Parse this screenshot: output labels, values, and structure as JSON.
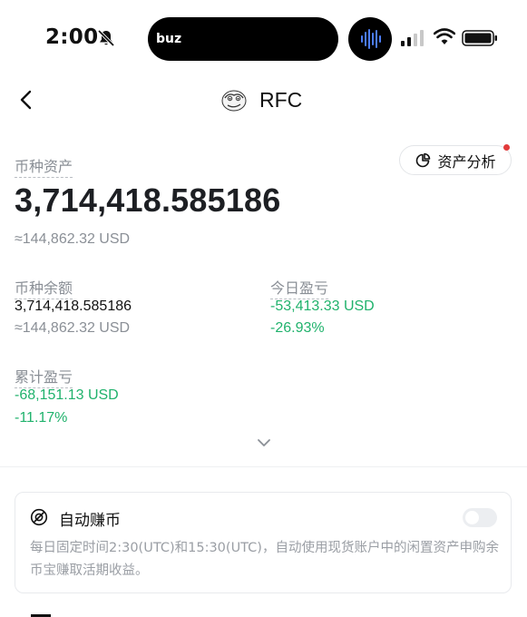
{
  "status_bar": {
    "time": "2:00",
    "island_label": "buz",
    "icons": [
      "bell-slash-icon",
      "audio-wave-icon",
      "signal-icon",
      "wifi-icon",
      "battery-icon"
    ]
  },
  "header": {
    "back_icon": "chevron-left-icon",
    "coin_logo": "pepe-logo",
    "title": "RFC"
  },
  "asset": {
    "label": "币种资产",
    "analysis_button": "资产分析",
    "amount": "3,714,418.585186",
    "usd": "≈144,862.32 USD"
  },
  "stats": {
    "balance": {
      "label": "币种余额",
      "amount": "3,714,418.585186",
      "usd": "≈144,862.32 USD"
    },
    "today_pnl": {
      "label": "今日盈亏",
      "amount": "-53,413.33 USD",
      "percent": "-26.93%"
    },
    "total_pnl": {
      "label": "累计盈亏",
      "amount": "-68,151.13 USD",
      "percent": "-11.17%"
    }
  },
  "auto_earn": {
    "title": "自动赚币",
    "description": "每日固定时间2:30(UTC)和15:30(UTC)，自动使用现货账户中的闲置资产申购余币宝赚取活期收益。",
    "enabled": false
  },
  "colors": {
    "loss": "#20b26c",
    "muted": "#8a8f96",
    "notification_dot": "#e23b3b"
  }
}
